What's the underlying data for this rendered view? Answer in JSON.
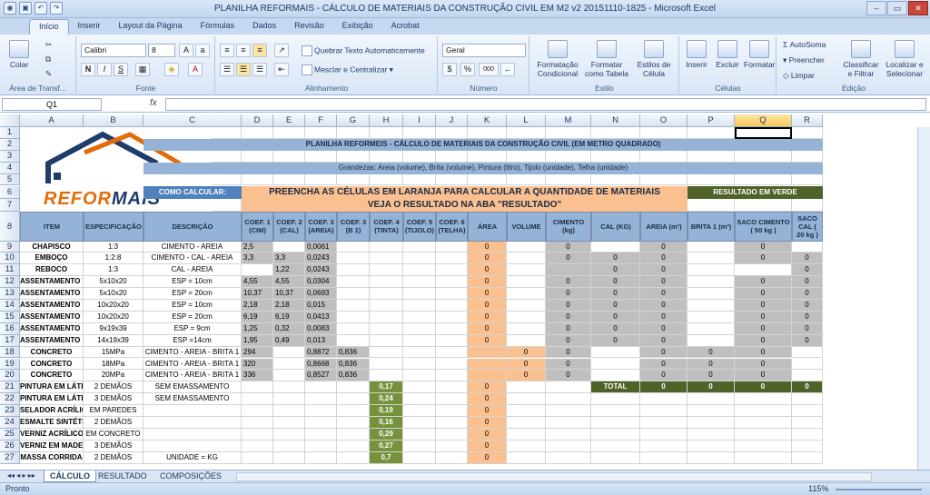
{
  "window": {
    "title": "PLANILHA REFORMAIS - CÁLCULO DE MATERIAIS DA CONSTRUÇÃO CIVIL EM M2 v2 20151110-1825  -  Microsoft Excel"
  },
  "tabs": [
    "Início",
    "Inserir",
    "Layout da Página",
    "Fórmulas",
    "Dados",
    "Revisão",
    "Exibição",
    "Acrobat"
  ],
  "ribbon": {
    "clipboard": {
      "paste": "Colar",
      "label": "Área de Transf..."
    },
    "font": {
      "name": "Calibri",
      "size": "8",
      "label": "Fonte"
    },
    "alignment": {
      "wrap": "Quebrar Texto Automaticamente",
      "merge": "Mesclar e Centralizar",
      "label": "Alinhamento"
    },
    "number": {
      "format": "Geral",
      "label": "Número"
    },
    "styles": {
      "conditional": "Formatação Condicional",
      "table": "Formatar como Tabela",
      "cell": "Estilos de Célula",
      "label": "Estilo"
    },
    "cells": {
      "insert": "Inserir",
      "delete": "Excluir",
      "format": "Formatar",
      "label": "Células"
    },
    "editing": {
      "autosum": "AutoSoma",
      "fill": "Preencher",
      "clear": "Limpar",
      "sort": "Classificar e Filtrar",
      "find": "Localizar e Selecionar",
      "label": "Edição"
    }
  },
  "formula": {
    "namebox": "Q1",
    "fx": "fx",
    "value": ""
  },
  "columns": [
    "A",
    "B",
    "C",
    "D",
    "E",
    "F",
    "G",
    "H",
    "I",
    "J",
    "K",
    "L",
    "M",
    "N",
    "O",
    "P",
    "Q",
    "R"
  ],
  "rows": [
    "1",
    "2",
    "3",
    "4",
    "5",
    "6",
    "7",
    "8",
    "9",
    "10",
    "11",
    "12",
    "13",
    "14",
    "15",
    "16",
    "17",
    "18",
    "19",
    "20",
    "21",
    "22",
    "23",
    "24",
    "25",
    "26",
    "27"
  ],
  "logo": {
    "text1": "REFOR",
    "text2": "MAIS"
  },
  "title": "PLANILHA REFORMEIS - CÁLCULO DE MATERIAIS DA CONSTRUÇÃO CIVIL (EM METRO QUADRADO)",
  "grandezas": "Grandezas: Areia (volume), Brita (volume), Pintura (litro), Tijolo (unidade), Telha (unidade)",
  "como": "COMO CALCULAR:",
  "instr1": "PREENCHA AS CÉLULAS EM LARANJA PARA CALCULAR A QUANTIDADE DE MATERIAIS",
  "instr2": "VEJA O RESULTADO NA ABA \"RESULTADO\"",
  "resultado": "RESULTADO EM VERDE",
  "headers": [
    "ITEM",
    "ESPECIFICAÇÃO",
    "DESCRIÇÃO",
    "COEF. 1 (CIM)",
    "COEF. 2 (CAL)",
    "COEF. 3 (AREIA)",
    "COEF. 3 (B 1)",
    "COEF. 4 (TINTA)",
    "COEF. 5 (TIJOLO)",
    "COEF. 6 (TELHA)",
    "ÁREA",
    "VOLUME",
    "CIMENTO (kg)",
    "CAL (KG)",
    "AREIA (m³)",
    "BRITA 1 (m³)",
    "SACO CIMENTO ( 50 kg )",
    "SACO CAL ( 20 kg )"
  ],
  "data": [
    [
      "CHAPISCO",
      "1:3",
      "CIMENTO - AREIA",
      "2,5",
      "",
      "0,0061",
      "",
      "",
      "",
      "",
      "0",
      "",
      "0",
      "",
      "0",
      "",
      "0",
      ""
    ],
    [
      "EMBOÇO",
      "1:2:8",
      "CIMENTO - CAL - AREIA",
      "3,3",
      "3,3",
      "0,0243",
      "",
      "",
      "",
      "",
      "0",
      "",
      "0",
      "0",
      "0",
      "",
      "0",
      "0"
    ],
    [
      "REBOCO",
      "1:3",
      "CAL - AREIA",
      "",
      "1,22",
      "0,0243",
      "",
      "",
      "",
      "",
      "0",
      "",
      "",
      "0",
      "0",
      "",
      "",
      "0"
    ],
    [
      "ASSENTAMENTO TIJOLO MACIÇO",
      "5x10x20",
      "ESP = 10cm",
      "4,55",
      "4,55",
      "0,0304",
      "",
      "",
      "",
      "",
      "0",
      "",
      "0",
      "0",
      "0",
      "",
      "0",
      "0"
    ],
    [
      "ASSENTAMENTO TIJOLO MACIÇO",
      "5x10x20",
      "ESP = 20cm",
      "10,37",
      "10,37",
      "0,0693",
      "",
      "",
      "",
      "",
      "0",
      "",
      "0",
      "0",
      "0",
      "",
      "0",
      "0"
    ],
    [
      "ASSENTAMENTO TIJOLO FURADO",
      "10x20x20",
      "ESP = 10cm",
      "2,18",
      "2,18",
      "0,015",
      "",
      "",
      "",
      "",
      "0",
      "",
      "0",
      "0",
      "0",
      "",
      "0",
      "0"
    ],
    [
      "ASSENTAMENTO TIJOLO FURADO",
      "10x20x20",
      "ESP = 20cm",
      "6,19",
      "6,19",
      "0,0413",
      "",
      "",
      "",
      "",
      "0",
      "",
      "0",
      "0",
      "0",
      "",
      "0",
      "0"
    ],
    [
      "ASSENTAMENTO BLOCO CONCRETO",
      "9x19x39",
      "ESP = 9cm",
      "1,25",
      "0,32",
      "0,0083",
      "",
      "",
      "",
      "",
      "0",
      "",
      "0",
      "0",
      "0",
      "",
      "0",
      "0"
    ],
    [
      "ASSENTAMENTO BLOCO CONCRETO",
      "14x19x39",
      "ESP =14cm",
      "1,95",
      "0,49",
      "0,013",
      "",
      "",
      "",
      "",
      "0",
      "",
      "0",
      "0",
      "0",
      "",
      "0",
      "0"
    ],
    [
      "CONCRETO",
      "15MPa",
      "CIMENTO - AREIA - BRITA 1",
      "294",
      "",
      "0,8872",
      "0,836",
      "",
      "",
      "",
      "",
      "0",
      "0",
      "",
      "0",
      "0",
      "0",
      ""
    ],
    [
      "CONCRETO",
      "18MPa",
      "CIMENTO - AREIA - BRITA 1",
      "320",
      "",
      "0,8668",
      "0,836",
      "",
      "",
      "",
      "",
      "0",
      "0",
      "",
      "0",
      "0",
      "0",
      ""
    ],
    [
      "CONCRETO",
      "20MPa",
      "CIMENTO - AREIA - BRITA 1",
      "336",
      "",
      "0,8527",
      "0,836",
      "",
      "",
      "",
      "",
      "0",
      "0",
      "",
      "0",
      "0",
      "0",
      ""
    ],
    [
      "PINTURA EM LÁTEX",
      "2  DEMÃOS",
      "SEM  EMASSAMENTO",
      "",
      "",
      "",
      "",
      "0,17",
      "",
      "",
      "0",
      "",
      "",
      "TOTAL",
      "0",
      "0",
      "0",
      "0"
    ],
    [
      "PINTURA EM LÁTEX",
      "3  DEMÃOS",
      "SEM  EMASSAMENTO",
      "",
      "",
      "",
      "",
      "0,24",
      "",
      "",
      "0",
      "",
      "",
      "",
      "",
      "",
      "",
      ""
    ],
    [
      "SELADOR ACRÍLICO",
      "EM PAREDES",
      "",
      "",
      "",
      "",
      "",
      "0,19",
      "",
      "",
      "0",
      "",
      "",
      "",
      "",
      "",
      "",
      ""
    ],
    [
      "ESMALTE SINTÉTICO",
      "2  DEMÃOS",
      "",
      "",
      "",
      "",
      "",
      "0,16",
      "",
      "",
      "0",
      "",
      "",
      "",
      "",
      "",
      "",
      ""
    ],
    [
      "VERNIZ  ACRÍLICO",
      "EM CONCRETO",
      "",
      "",
      "",
      "",
      "",
      "0,29",
      "",
      "",
      "0",
      "",
      "",
      "",
      "",
      "",
      "",
      ""
    ],
    [
      "VERNIZ EM MADEIRA",
      "3  DEMÃOS",
      "",
      "",
      "",
      "",
      "",
      "0,27",
      "",
      "",
      "0",
      "",
      "",
      "",
      "",
      "",
      "",
      ""
    ],
    [
      "MASSA CORRIDA",
      "2 DEMÃOS",
      "UNIDADE = KG",
      "",
      "",
      "",
      "",
      "0,7",
      "",
      "",
      "0",
      "",
      "",
      "",
      "",
      "",
      "",
      ""
    ]
  ],
  "sheets": [
    "CÁLCULO",
    "RESULTADO",
    "COMPOSIÇÕES"
  ],
  "status": {
    "ready": "Pronto",
    "zoom": "115%"
  }
}
